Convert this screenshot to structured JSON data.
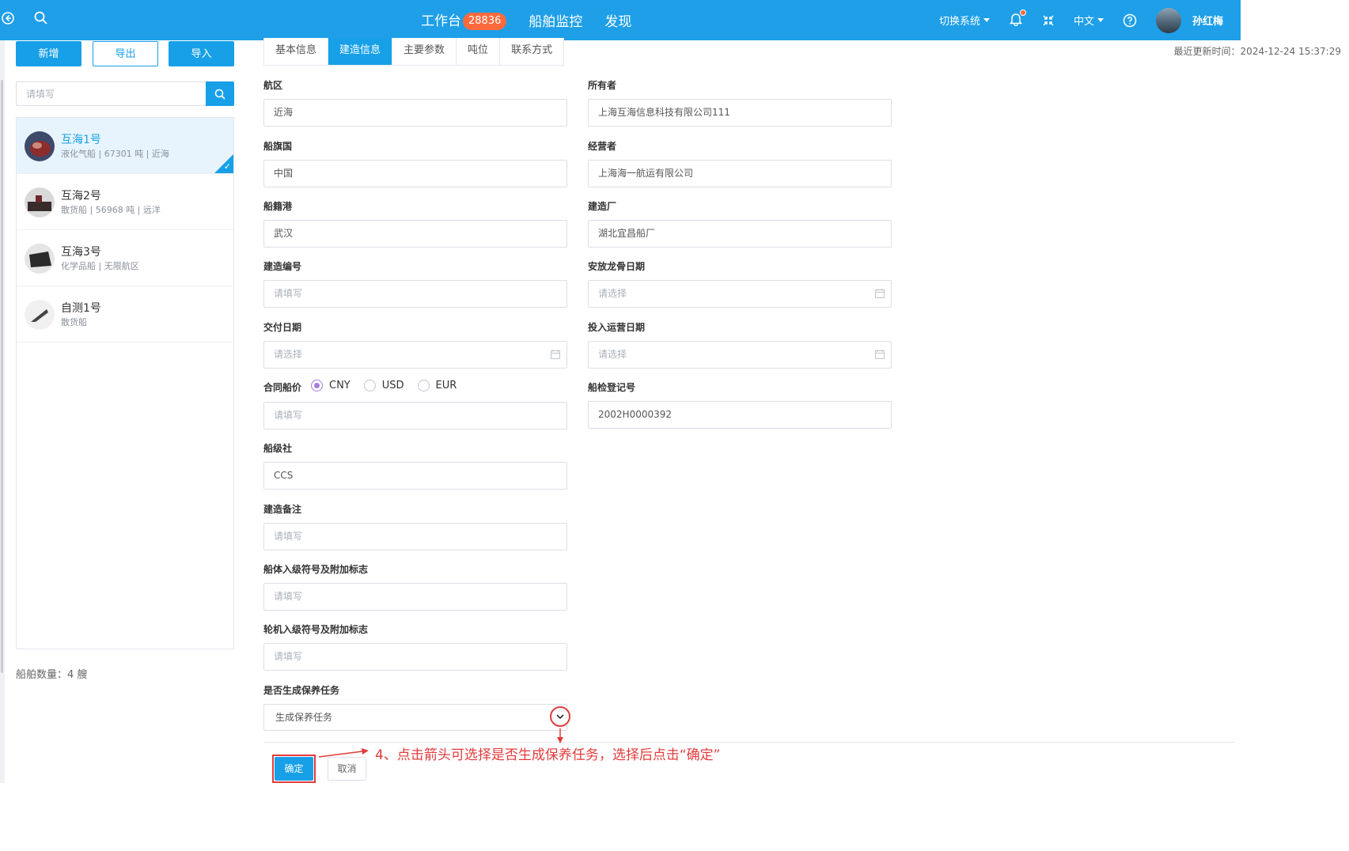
{
  "header": {
    "nav": [
      {
        "label": "工作台",
        "badge": "28836"
      },
      {
        "label": "船舶监控"
      },
      {
        "label": "发现"
      }
    ],
    "switch_system": "切换系统",
    "language": "中文",
    "user_name": "孙红梅"
  },
  "colors": {
    "primary": "#17a0e8",
    "header_bg": "#1e9fe8",
    "badge": "#ff6a3d",
    "annotation": "#e23b3b",
    "radio_checked": "#a67de0"
  },
  "toolbar": {
    "add_label": "新增",
    "export_label": "导出",
    "import_label": "导入"
  },
  "search": {
    "placeholder": "请填写"
  },
  "ships": [
    {
      "name": "互海1号",
      "meta": "液化气船 | 67301 吨 | 近海",
      "selected": true
    },
    {
      "name": "互海2号",
      "meta": "散货船 | 56968 吨 | 远洋",
      "selected": false
    },
    {
      "name": "互海3号",
      "meta": "化学品船 | 无限航区",
      "selected": false
    },
    {
      "name": "自测1号",
      "meta": "散货船",
      "selected": false
    }
  ],
  "ship_count": "船舶数量：4 艘",
  "tabs": [
    "基本信息",
    "建造信息",
    "主要参数",
    "吨位",
    "联系方式"
  ],
  "active_tab": "建造信息",
  "update_time": "最近更新时间：2024-12-24 15:37:29",
  "form": {
    "area": {
      "label": "航区",
      "value": "近海"
    },
    "owner": {
      "label": "所有者",
      "value": "上海互海信息科技有限公司111"
    },
    "flag": {
      "label": "船旗国",
      "value": "中国"
    },
    "operator": {
      "label": "经营者",
      "value": "上海海一航运有限公司"
    },
    "port": {
      "label": "船籍港",
      "value": "武汉"
    },
    "builder": {
      "label": "建造厂",
      "value": "湖北宜昌船厂"
    },
    "build_no": {
      "label": "建造编号",
      "placeholder": "请填写"
    },
    "keel_date": {
      "label": "安放龙骨日期",
      "placeholder": "请选择"
    },
    "delivery_date": {
      "label": "交付日期",
      "placeholder": "请选择"
    },
    "operation_date": {
      "label": "投入运营日期",
      "placeholder": "请选择"
    },
    "contract_price": {
      "label": "合同船价",
      "placeholder": "请填写",
      "currencies": [
        "CNY",
        "USD",
        "EUR"
      ],
      "selected_currency": "CNY"
    },
    "inspection_no": {
      "label": "船检登记号",
      "value": "2002H0000392"
    },
    "class_society": {
      "label": "船级社",
      "value": "CCS"
    },
    "build_remark": {
      "label": "建造备注",
      "placeholder": "请填写"
    },
    "hull_class": {
      "label": "船体入级符号及附加标志",
      "placeholder": "请填写"
    },
    "engine_class": {
      "label": "轮机入级符号及附加标志",
      "placeholder": "请填写"
    },
    "maintenance": {
      "label": "是否生成保养任务",
      "value": "生成保养任务"
    }
  },
  "buttons": {
    "ok": "确定",
    "cancel": "取消"
  },
  "annotation": "4、点击箭头可选择是否生成保养任务，选择后点击“确定”"
}
